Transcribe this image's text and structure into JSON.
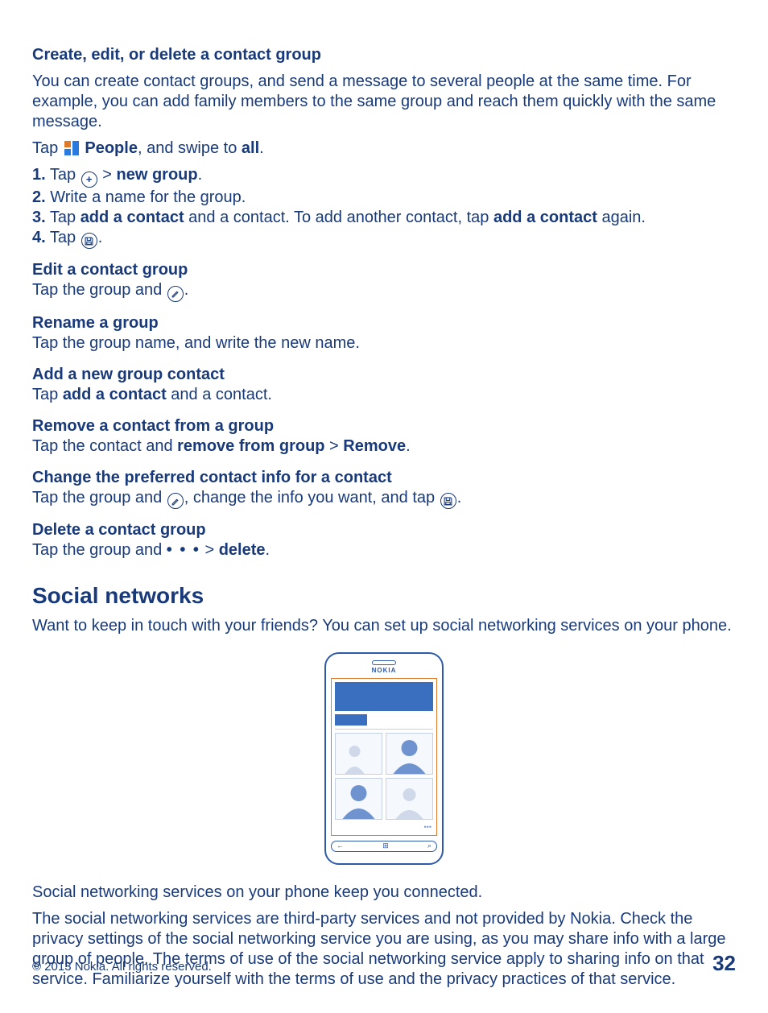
{
  "headings": {
    "h1": "Create, edit, or delete a contact group",
    "intro": "You can create contact groups, and send a message to several people at the same time. For example, you can add family members to the same group and reach them quickly with the same message.",
    "tap_line_prefix": "Tap ",
    "people_bold": "People",
    "tap_line_mid": ", and swipe to ",
    "all_bold": "all",
    "period": "."
  },
  "steps": {
    "s1": {
      "num": "1.",
      "pre": " Tap ",
      "sep_gt": " > ",
      "new_group": "new group"
    },
    "s2": {
      "num": "2.",
      "text": " Write a name for the group."
    },
    "s3": {
      "num": "3.",
      "pre": " Tap ",
      "addc": "add a contact",
      "mid": " and a contact. To add another contact, tap ",
      "again": " again."
    },
    "s4": {
      "num": "4.",
      "pre": " Tap "
    }
  },
  "edit": {
    "title": "Edit a contact group",
    "pre": "Tap the group and "
  },
  "rename": {
    "title": "Rename a group",
    "body": "Tap the group name, and write the new name."
  },
  "addnew": {
    "title": "Add a new group contact",
    "pre": "Tap ",
    "addc": "add a contact",
    "post": " and a contact."
  },
  "remove": {
    "title": "Remove a contact from a group",
    "pre": "Tap the contact and ",
    "rfg": "remove from group",
    "gt": " > ",
    "rm": "Remove"
  },
  "changepref": {
    "title": "Change the preferred contact info for a contact",
    "pre": "Tap the group and ",
    "mid": ", change the info you want, and tap "
  },
  "delete": {
    "title": "Delete a contact group",
    "pre": "Tap the group and  ",
    "dots": "• • •",
    "gt": "  > ",
    "del": "delete"
  },
  "social": {
    "heading": "Social networks",
    "intro": "Want to keep in touch with your friends? You can set up social networking services on your phone.",
    "nokia": "NOKIA",
    "after_img": "Social networking services on your phone keep you connected.",
    "disclaimer": "The social networking services are third-party services and not provided by Nokia. Check the privacy settings of the social networking service you are using, as you may share info with a large group of people. The terms of use of the social networking service apply to sharing info on that service. Familiarize yourself with the terms of use and the privacy practices of that service."
  },
  "footer": {
    "copyright": "© 2013 Nokia. All rights reserved.",
    "page": "32"
  }
}
